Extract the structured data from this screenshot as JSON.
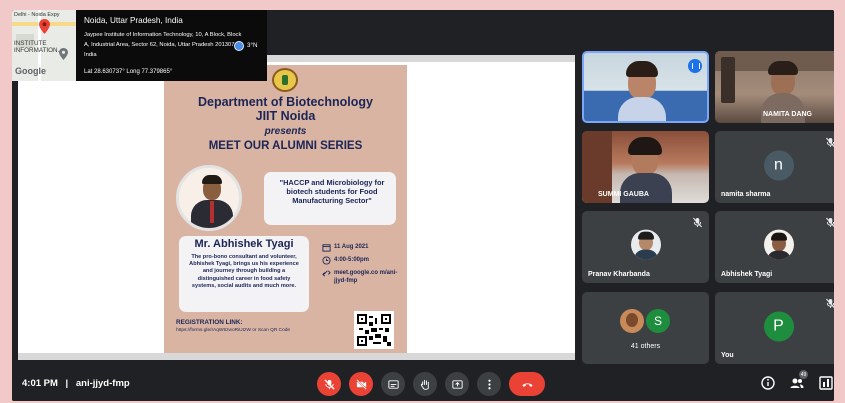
{
  "location": {
    "map_top_label": "Delhi - Noida Expy",
    "map_mid_label": "INSTITUTE\nINFORMATION...",
    "google_label": "Google",
    "city": "Noida, Uttar Pradesh, India",
    "address": "Jaypee Institute of Information Technology, 10, A Block, Block A, Industrial Area, Sector 62, Noida, Uttar Pradesh 201307, India",
    "degree_label": "3°N",
    "latlong": "Lat 28.630737° Long 77.379865°"
  },
  "poster": {
    "dept": "Department of Biotechnology\nJIIT Noida",
    "presents": "presents",
    "series": "MEET OUR ALUMNI SERIES",
    "quote": "\"HACCP and Microbiology for biotech students for Food Manufacturing Sector\"",
    "speaker_name": "Mr. Abhishek Tyagi",
    "speaker_bio": "The pro-bono consultant and volunteer, Abhishek Tyagi, brings us his experience and journey through building a distinguished career in food safety systems, social audits and much more.",
    "date": "11 Aug 2021",
    "time": "4:00-5:00pm",
    "link": "meet.google.co m/ani-jjyd-fmp",
    "reg_title": "REGISTRATION LINK:",
    "reg_text": "https://forms.gle/rAqW5zwoRiUtzW or Scan QR Code"
  },
  "participants": [
    {
      "name": "",
      "type": "video",
      "speaking": true
    },
    {
      "name": "NAMITA DANG",
      "type": "video",
      "speaking": false
    },
    {
      "name": "SUMMI GAUBA",
      "type": "video",
      "speaking": false
    },
    {
      "name": "namita sharma",
      "type": "letter",
      "letter": "n",
      "color": "#4a5a65",
      "muted": true
    },
    {
      "name": "Pranav Kharbanda",
      "type": "photo",
      "muted": true
    },
    {
      "name": "Abhishek Tyagi",
      "type": "photo",
      "muted": true
    },
    {
      "name": "41 others",
      "type": "group",
      "letter": "S",
      "muted": true
    },
    {
      "name": "You",
      "type": "letter",
      "letter": "P",
      "color": "#1e8e3e",
      "muted": true
    }
  ],
  "meeting": {
    "time": "4:01 PM",
    "code": "ani-jjyd-fmp",
    "separator": "|",
    "people_count": "49"
  },
  "colors": {
    "background": "#f2c9c9",
    "meet_dark": "#202124",
    "tile": "#3c4043",
    "red": "#ea4335"
  }
}
